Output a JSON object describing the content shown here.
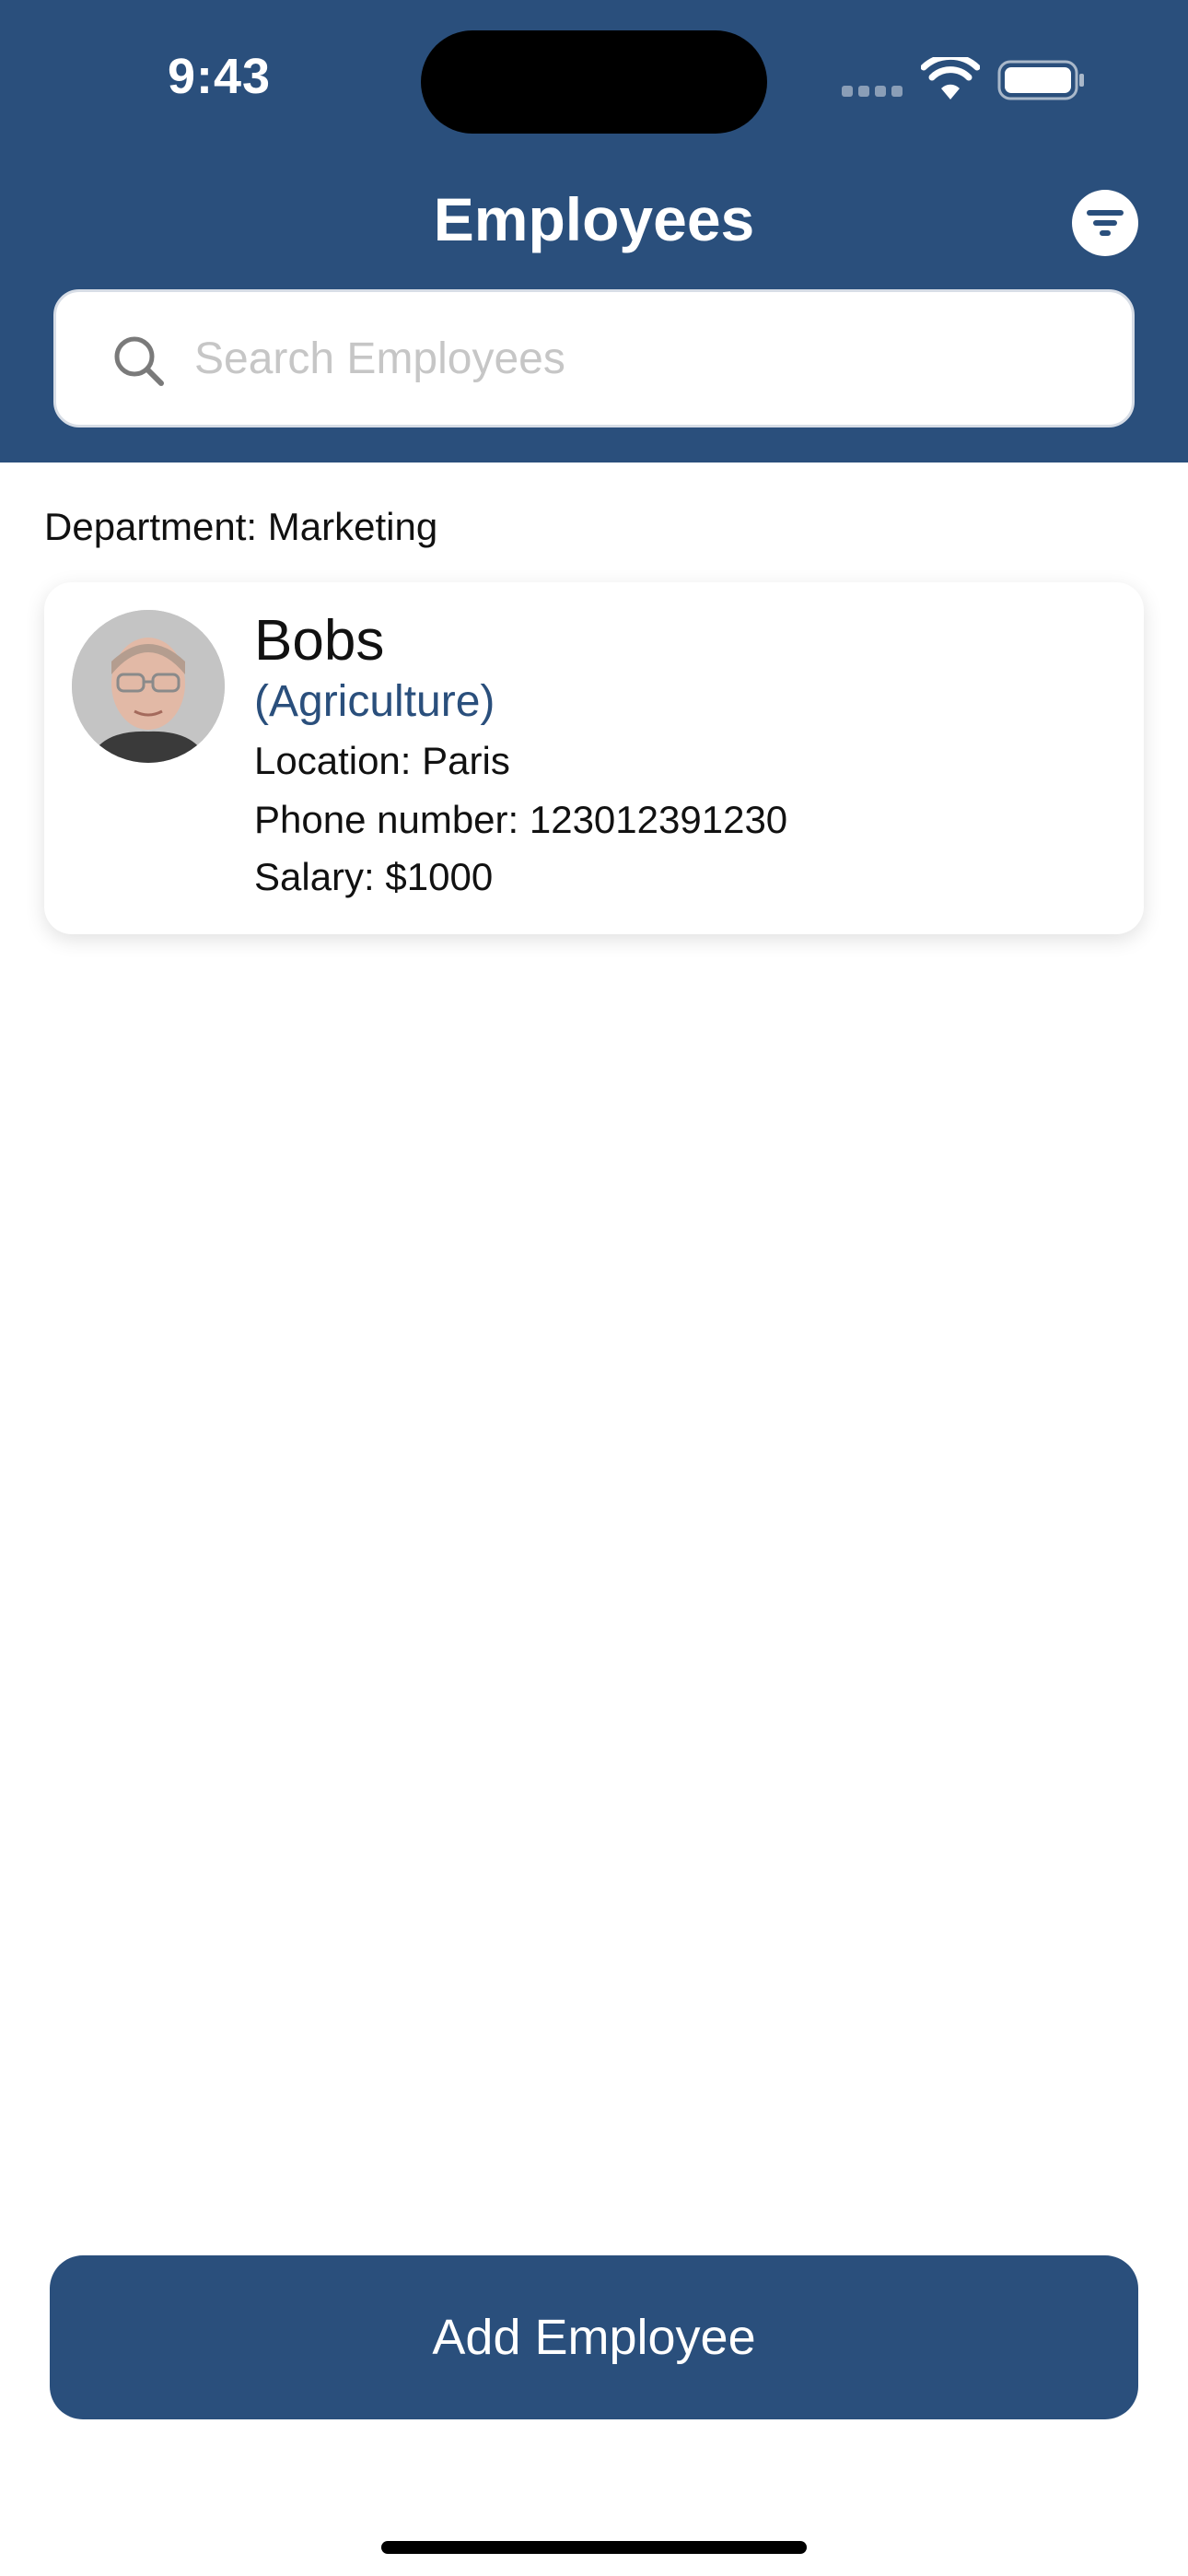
{
  "status_bar": {
    "time": "9:43"
  },
  "header": {
    "title": "Employees",
    "filter_icon": "filter-icon"
  },
  "search": {
    "placeholder": "Search Employees",
    "value": "",
    "icon": "search-icon"
  },
  "department": {
    "label": "Department: Marketing"
  },
  "employees": [
    {
      "name": "Bobs",
      "department": "(Agriculture)",
      "location": "Location: Paris",
      "phone": "Phone number: 123012391230",
      "salary": "Salary: $1000"
    }
  ],
  "actions": {
    "add_employee_label": "Add Employee"
  },
  "colors": {
    "primary": "#2a4f7c",
    "background": "#ffffff"
  }
}
